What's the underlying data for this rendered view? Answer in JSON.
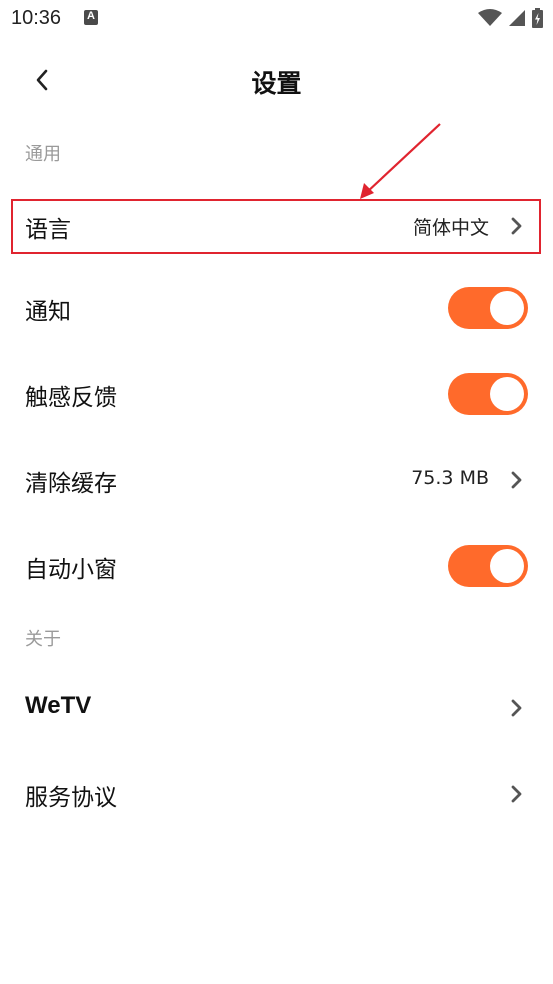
{
  "status_bar": {
    "time": "10:36",
    "icons": [
      "app-notification-icon",
      "wifi-icon",
      "cellular-signal-icon",
      "battery-charging-icon"
    ]
  },
  "header": {
    "title": "设置",
    "back_icon": "chevron-left-icon"
  },
  "sections": {
    "general": {
      "title": "通用",
      "items": {
        "language": {
          "label": "语言",
          "value": "简体中文"
        },
        "notification": {
          "label": "通知",
          "toggle": true
        },
        "haptics": {
          "label": "触感反馈",
          "toggle": true
        },
        "clear_cache": {
          "label": "清除缓存",
          "value": "75.3 MB"
        },
        "auto_pip": {
          "label": "自动小窗",
          "toggle": true
        }
      }
    },
    "about": {
      "title": "关于",
      "items": {
        "wetv": {
          "label": "WeTV"
        },
        "terms": {
          "label": "服务协议"
        }
      }
    }
  },
  "colors": {
    "toggle_on": "#ff6a2b",
    "annotation_red": "#e0242f",
    "section_gray": "#9a9a9a"
  }
}
